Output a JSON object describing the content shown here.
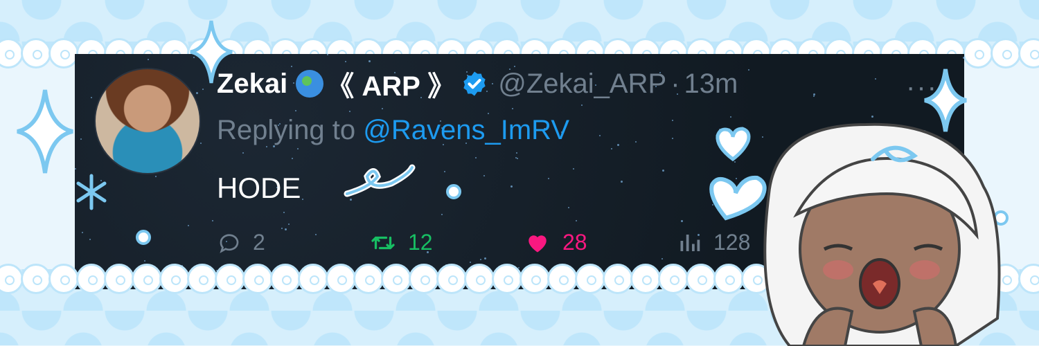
{
  "colors": {
    "tweet_bg": "#15202b",
    "muted": "#71808f",
    "link": "#1d9bf0",
    "retweet": "#17bf63",
    "like": "#f91880",
    "lace": "#bde5fa"
  },
  "tweet": {
    "display_name": "Zekai",
    "emoji_icon": "globe-icon",
    "name_suffix": "《 ARP 》",
    "verified_icon": "verified-badge-icon",
    "handle": "@Zekai_ARP",
    "separator": "·",
    "time": "13m",
    "more_icon": "more-icon",
    "more_glyph": "···",
    "replying_to_label": "Replying to",
    "replying_to_handle": "@Ravens_ImRV",
    "text": "HODE"
  },
  "actions": {
    "reply": {
      "icon": "reply-icon",
      "count": "2"
    },
    "retweet": {
      "icon": "retweet-icon",
      "count": "12"
    },
    "like": {
      "icon": "heart-icon",
      "count": "28"
    },
    "views": {
      "icon": "views-icon",
      "count": "128"
    }
  }
}
